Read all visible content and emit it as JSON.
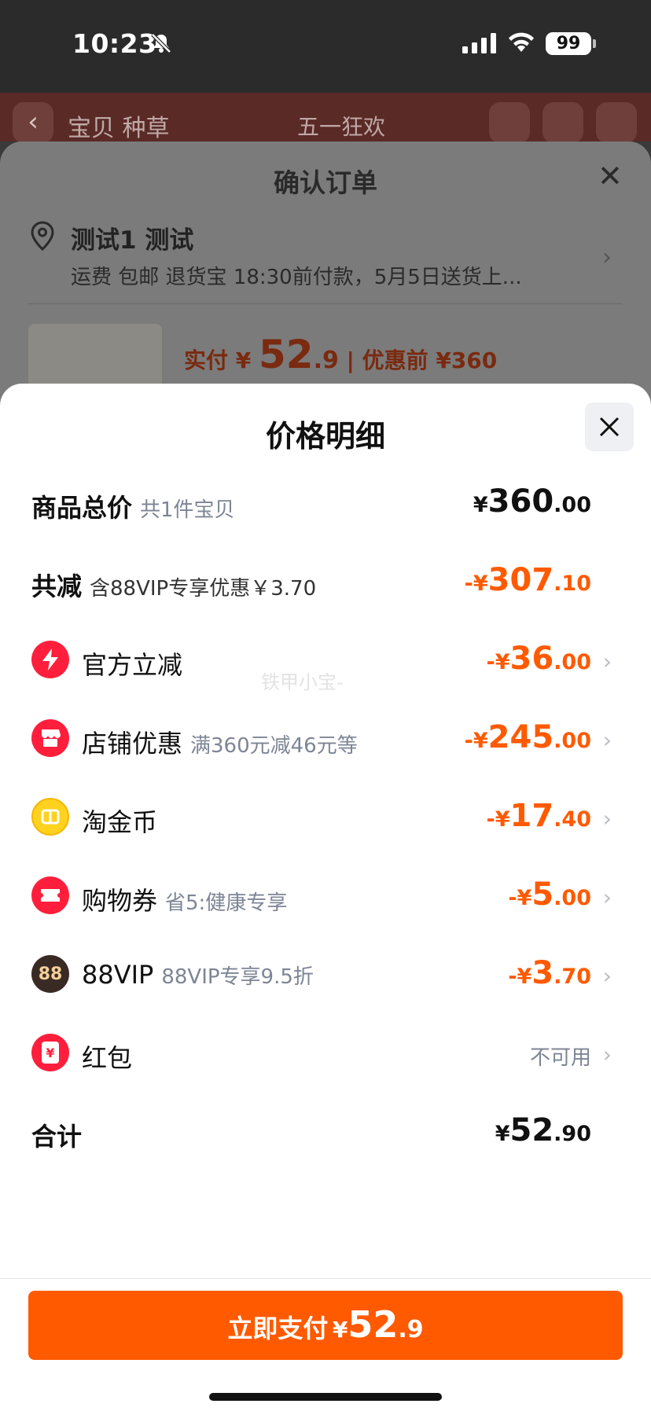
{
  "status_bar": {
    "time": "10:23",
    "battery": "99"
  },
  "background_page": {
    "title": "宝贝  种草",
    "shop_title": "五一狂欢"
  },
  "order_sheet": {
    "title": "确认订单",
    "address_name": "测试1 测试",
    "address_detail": "运费 包邮 退货宝 18:30前付款，5月5日送货上...",
    "paid_label": "实付 ¥",
    "paid_int": "52",
    "paid_dec": ".9",
    "before_discount": "| 优惠前 ¥360"
  },
  "price_detail": {
    "title": "价格明细",
    "watermark": "铁甲小宝-",
    "rows": [
      {
        "label": "商品总价",
        "sub": "共1件宝贝",
        "cur": "¥",
        "int": "360",
        "dec": ".00"
      },
      {
        "label": "共减",
        "sub": "含88VIP专享优惠￥3.70",
        "cur": "-¥",
        "int": "307",
        "dec": ".10"
      },
      {
        "label": "官方立减",
        "sub": "",
        "cur": "-¥",
        "int": "36",
        "dec": ".00"
      },
      {
        "label": "店铺优惠",
        "sub": "满360元减46元等",
        "cur": "-¥",
        "int": "245",
        "dec": ".00"
      },
      {
        "label": "淘金币",
        "sub": "",
        "cur": "-¥",
        "int": "17",
        "dec": ".40"
      },
      {
        "label": "购物券",
        "sub": "省5:健康专享",
        "cur": "-¥",
        "int": "5",
        "dec": ".00"
      },
      {
        "label": "88VIP",
        "sub": "88VIP专享9.5折",
        "cur": "-¥",
        "int": "3",
        "dec": ".70",
        "icon_text": "88"
      },
      {
        "label": "红包",
        "sub": "",
        "status": "不可用",
        "icon_text": "¥"
      },
      {
        "label": "合计",
        "sub": "",
        "cur": "¥",
        "int": "52",
        "dec": ".90"
      }
    ]
  },
  "pay_button": {
    "label": "立即支付",
    "cur": "¥",
    "int": "52",
    "dec": ".9"
  },
  "colors": {
    "accent": "#ff5a00",
    "sub_text": "#7d8595"
  },
  "icons": [
    "location-pin-icon",
    "lightning-icon",
    "shop-icon",
    "coin-icon",
    "ticket-icon",
    "vip-88-icon",
    "red-packet-icon",
    "chevron-right-icon",
    "close-icon"
  ]
}
